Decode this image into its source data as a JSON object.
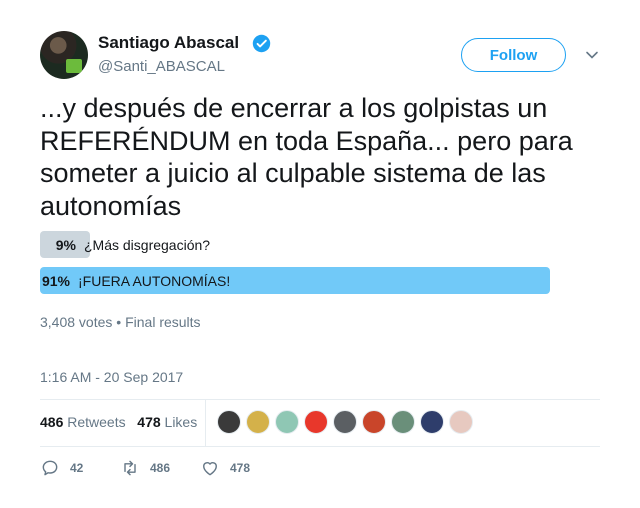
{
  "author": {
    "name": "Santiago Abascal",
    "handle": "@Santi_ABASCAL",
    "verified": true
  },
  "follow_label": "Follow",
  "tweet_text": "...y después de encerrar a los golpistas un REFERÉNDUM en toda España... pero para someter a juicio al culpable sistema de las autonomías",
  "poll": {
    "options": [
      {
        "percent": "9%",
        "label": "¿Más disgregación?",
        "share": 0.09
      },
      {
        "percent": "91%",
        "label": "¡FUERA AUTONOMÍAS!",
        "share": 0.91
      }
    ],
    "votes": "3,408 votes",
    "status": "Final results"
  },
  "timestamp": "1:16 AM - 20 Sep 2017",
  "stats": {
    "retweets_count": "486",
    "retweets_label": "Retweets",
    "likes_count": "478",
    "likes_label": "Likes"
  },
  "actions": {
    "replies": "42",
    "retweets": "486",
    "likes": "478"
  },
  "icons": {
    "verified": "verified-badge-icon",
    "caret": "chevron-down-icon",
    "reply": "reply-icon",
    "retweet": "retweet-icon",
    "like": "heart-icon"
  },
  "colors": {
    "accent": "#1da1f2",
    "poll_winner": "#71c9f8",
    "poll_loser": "#ccd6dd",
    "muted": "#657786"
  }
}
